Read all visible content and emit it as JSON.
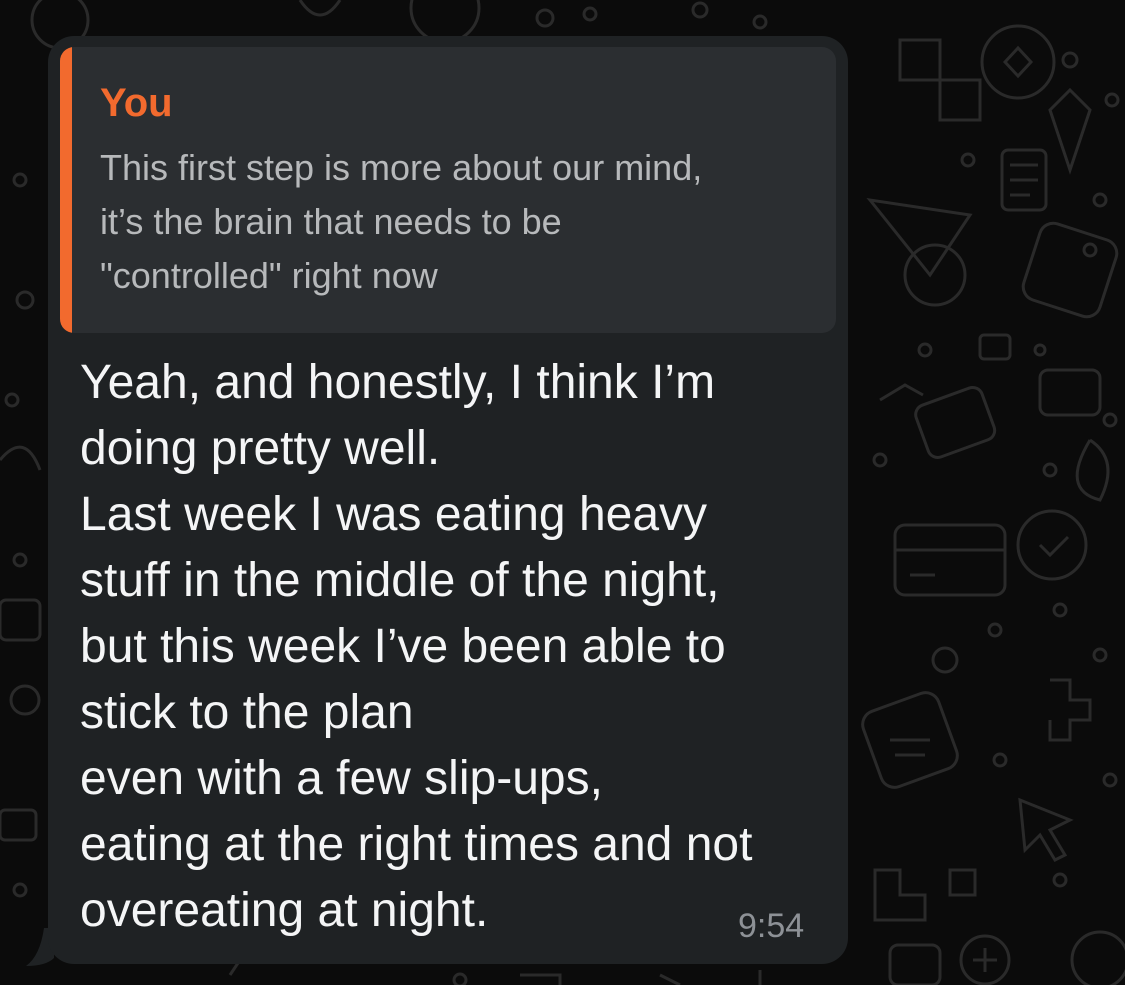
{
  "chat": {
    "background_color": "#0b0b0b",
    "bubble_color": "#1f2224",
    "accent_color": "#f26a2e"
  },
  "reply_quote": {
    "author": "You",
    "text_lines": [
      "This first step is more about our mind,",
      "it’s the brain that needs to be",
      "\"controlled\" right now"
    ]
  },
  "message": {
    "lines": [
      "Yeah, and honestly, I think I’m",
      "doing pretty well.",
      "Last week I was eating heavy",
      "stuff in the middle of the night,",
      "but this week I’ve been able to",
      "stick to the plan",
      "even with a few slip-ups,",
      "eating at the right times and not",
      "overeating at night."
    ],
    "time": "9:54"
  }
}
